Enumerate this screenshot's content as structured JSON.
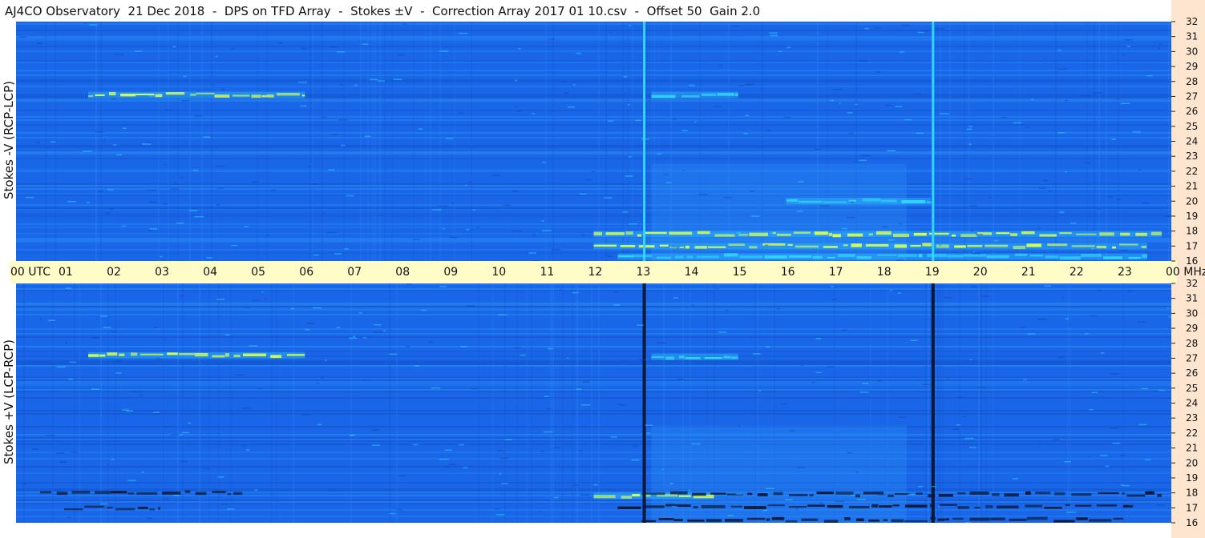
{
  "title": "AJ4CO Observatory  21 Dec 2018  -  DPS on TFD Array  -  Stokes ±V  -  Correction Array 2017 01 10.csv  -  Offset 50  Gain 2.0",
  "chart_data": [
    {
      "type": "heatmap",
      "panel": "top",
      "ylabel": "Stokes -V (RCP-LCP)",
      "y_unit": "MHz",
      "ylim": [
        16,
        32
      ],
      "y_ticks": [
        "16",
        "17",
        "18",
        "19",
        "20",
        "21",
        "22",
        "23",
        "24",
        "25",
        "26",
        "27",
        "28",
        "29",
        "30",
        "31",
        "32"
      ],
      "xlim": [
        0,
        24
      ],
      "features": [
        {
          "kind": "bright_band",
          "x": [
            1.5,
            6.0
          ],
          "freq": 27.1,
          "level": "high"
        },
        {
          "kind": "bright_band",
          "x": [
            12.0,
            23.8
          ],
          "freq": 17.8,
          "level": "high"
        },
        {
          "kind": "bright_band",
          "x": [
            12.0,
            23.5
          ],
          "freq": 17.0,
          "level": "high"
        },
        {
          "kind": "bright_band",
          "x": [
            12.5,
            23.5
          ],
          "freq": 16.3,
          "level": "medium"
        },
        {
          "kind": "bright_band",
          "x": [
            13.2,
            15.0
          ],
          "freq": 27.1,
          "level": "medium"
        },
        {
          "kind": "bright_band",
          "x": [
            16.0,
            19.0
          ],
          "freq": 20.0,
          "level": "low"
        },
        {
          "kind": "vertical_line",
          "x": 13.05,
          "level": "high"
        },
        {
          "kind": "vertical_line",
          "x": 19.05,
          "level": "high"
        }
      ]
    },
    {
      "type": "heatmap",
      "panel": "bottom",
      "ylabel": "Stokes +V (LCP-RCP)",
      "y_unit": "MHz",
      "ylim": [
        16,
        32
      ],
      "y_ticks": [
        "16",
        "17",
        "18",
        "19",
        "20",
        "21",
        "22",
        "23",
        "24",
        "25",
        "26",
        "27",
        "28",
        "29",
        "30",
        "31",
        "32"
      ],
      "xlim": [
        0,
        24
      ],
      "features": [
        {
          "kind": "bright_band",
          "x": [
            1.5,
            6.0
          ],
          "freq": 27.2,
          "level": "high"
        },
        {
          "kind": "bright_band",
          "x": [
            13.2,
            15.0
          ],
          "freq": 27.1,
          "level": "medium"
        },
        {
          "kind": "bright_band",
          "x": [
            12.0,
            14.5
          ],
          "freq": 17.8,
          "level": "high"
        },
        {
          "kind": "dark_band",
          "x": [
            13.0,
            23.8
          ],
          "freq": 17.9
        },
        {
          "kind": "dark_band",
          "x": [
            12.5,
            23.2
          ],
          "freq": 17.1
        },
        {
          "kind": "dark_band",
          "x": [
            13.0,
            23.0
          ],
          "freq": 16.2
        },
        {
          "kind": "dark_band",
          "x": [
            0.5,
            4.7
          ],
          "freq": 18.0
        },
        {
          "kind": "dark_band",
          "x": [
            1.0,
            3.0
          ],
          "freq": 17.0
        },
        {
          "kind": "vertical_line",
          "x": 13.05,
          "level": "dark"
        },
        {
          "kind": "vertical_line",
          "x": 19.05,
          "level": "dark"
        }
      ]
    }
  ],
  "time_axis": {
    "labels": [
      "00 UTC",
      "01",
      "02",
      "03",
      "04",
      "05",
      "06",
      "07",
      "08",
      "09",
      "10",
      "11",
      "12",
      "13",
      "14",
      "15",
      "16",
      "17",
      "18",
      "19",
      "20",
      "21",
      "22",
      "23",
      "00 MHz"
    ],
    "background": "#fffcc8"
  },
  "colors": {
    "base": "#1966e8",
    "base_light": "#2a8ef5",
    "bright": "#32d7ff",
    "hot": "#d8ff50",
    "dark": "#0b1736",
    "timebar": "#fffcc8",
    "rightstrip": "#fde5cf"
  }
}
